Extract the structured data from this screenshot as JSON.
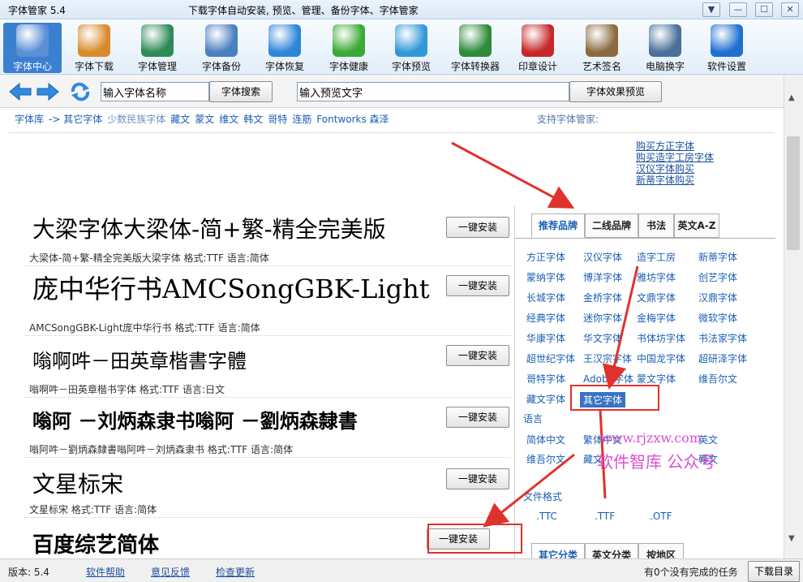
{
  "window": {
    "app_title": "字体管家 5.4",
    "center_title": "下载字体自动安装, 预览、管理、备份字体、字体管家",
    "controls": [
      "▼",
      "—",
      "☐",
      "✕"
    ]
  },
  "toolbar": {
    "items": [
      {
        "label": "字体中心",
        "icon": "home-icon",
        "color": "#5b8fd6"
      },
      {
        "label": "字体下载",
        "icon": "download-box-icon",
        "color": "#d98b2b"
      },
      {
        "label": "字体管理",
        "icon": "font-manage-icon",
        "color": "#2e8b57"
      },
      {
        "label": "字体备份",
        "icon": "document-icon",
        "color": "#4a7fc1"
      },
      {
        "label": "字体恢复",
        "icon": "restore-icon",
        "color": "#2f86d8"
      },
      {
        "label": "字体健康",
        "icon": "medical-kit-icon",
        "color": "#3aaa35"
      },
      {
        "label": "字体预览",
        "icon": "magnifier-icon",
        "color": "#3398d8"
      },
      {
        "label": "字体转换器",
        "icon": "converter-icon",
        "color": "#2e8b3a"
      },
      {
        "label": "印章设计",
        "icon": "seal-icon",
        "color": "#c62828"
      },
      {
        "label": "艺术签名",
        "icon": "signature-icon",
        "color": "#8b6b3e"
      },
      {
        "label": "电脑换字",
        "icon": "monitor-icon",
        "color": "#4a6f9a"
      },
      {
        "label": "软件设置",
        "icon": "gear-icon",
        "color": "#1f6fd1"
      }
    ]
  },
  "search": {
    "name_value": "输入字体名称",
    "search_button": "字体搜索",
    "preview_value": "输入预览文字",
    "preview_button": "字体效果预览"
  },
  "breadcrumb": {
    "items": [
      "字体库",
      "-> 其它字体",
      "少数民族字体",
      "藏文",
      "蒙文",
      "维文",
      "韩文",
      "哥特",
      "连筋",
      "Fontworks 森泽"
    ]
  },
  "support_text": "支持字体管家:",
  "buy_links": [
    "购买方正字体",
    "购买造字工房字体",
    "汉仪字体购买",
    "新蒂字体购买"
  ],
  "fonts": [
    {
      "sample": "大梁字体大梁体-简+繁-精全完美版",
      "meta": "大梁体-简+繁-精全完美版大梁字体  格式:TTF 语言:简体",
      "install": "一键安装"
    },
    {
      "sample": "庞中华行书AMCSongGBK-Light",
      "meta": "AMCSongGBK-Light庞中华行书  格式:TTF 语言:简体",
      "install": "一键安装"
    },
    {
      "sample": "嗡啊吽－田英章楷書字體",
      "meta": "嗡啊吽－田英章楷书字体  格式:TTF 语言:日文",
      "install": "一键安装"
    },
    {
      "sample": "嗡阿  －刘炳森隶书嗡阿  －劉炳森隸書",
      "meta": "嗡阿吽－劉炳森隸書嗡阿吽－刘炳森隶书  格式:TTF 语言:简体",
      "install": "一键安装"
    },
    {
      "sample": "文星标宋",
      "meta": "文星标宋  格式:TTF 语言:简体",
      "install": "一键安装"
    },
    {
      "sample": "百度综艺简体",
      "meta": "",
      "install": "一键安装"
    }
  ],
  "panel": {
    "tabs": [
      "推荐品牌",
      "二线品牌",
      "书法",
      "英文A-Z"
    ],
    "brands": [
      [
        "方正字体",
        "汉仪字体",
        "造字工房",
        "新蒂字体"
      ],
      [
        "蒙纳字体",
        "博洋字体",
        "雅坊字体",
        "创艺字体"
      ],
      [
        "长城字体",
        "金桥字体",
        "文鼎字体",
        "汉鼎字体"
      ],
      [
        "经典字体",
        "迷你字体",
        "金梅字体",
        "微软字体"
      ],
      [
        "华康字体",
        "华文字体",
        "书体坊字体",
        "书法家字体"
      ],
      [
        "超世纪字体",
        "王汉宗字体",
        "中国龙字体",
        "超研泽字体"
      ],
      [
        "哥特字体",
        "Adobe字体",
        "蒙文字体",
        "维吾尔文"
      ],
      [
        "藏文字体",
        "其它字体"
      ]
    ],
    "selected_brand": "其它字体",
    "language_title": "语言",
    "languages": [
      [
        "简体中文",
        "繁体中文",
        "",
        "英文"
      ],
      [
        "维吾尔文",
        "藏文",
        "",
        "韩文"
      ]
    ],
    "format_title": "文件格式",
    "formats": [
      ".TTC",
      ".TTF",
      ".OTF"
    ],
    "bottom_tabs": [
      "其它分类",
      "英文分类",
      "按地区"
    ]
  },
  "watermark": {
    "line1": "www.rjzxw.com",
    "line2": "软件智库 公众号"
  },
  "statusbar": {
    "version": "版本: 5.4",
    "help": "软件帮助",
    "feedback": "意见反馈",
    "update": "检查更新",
    "tasks": "有0个没有完成的任务",
    "download_dir": "下载目录"
  }
}
